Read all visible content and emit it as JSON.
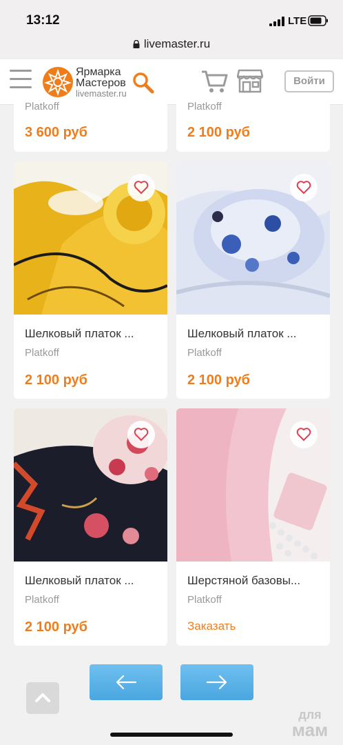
{
  "status_bar": {
    "time": "13:12",
    "network": "LTE"
  },
  "url_bar": {
    "url": "livemaster.ru"
  },
  "header": {
    "logo_line1": "Ярмарка",
    "logo_line2": "Мастеров",
    "logo_domain": "livemaster.ru",
    "login_label": "Войти"
  },
  "products": [
    {
      "title": "",
      "seller": "Platkoff",
      "price": "3 600 руб"
    },
    {
      "title": "",
      "seller": "Platkoff",
      "price": "2 100 руб"
    },
    {
      "title": "Шелковый платок ...",
      "seller": "Platkoff",
      "price": "2 100 руб"
    },
    {
      "title": "Шелковый платок ...",
      "seller": "Platkoff",
      "price": "2 100 руб"
    },
    {
      "title": "Шелковый платок ...",
      "seller": "Platkoff",
      "price": "2 100 руб"
    },
    {
      "title": "Шерстяной базовы...",
      "seller": "Platkoff",
      "action": "Заказать"
    }
  ],
  "watermark": {
    "line1": "для",
    "line2": "мам"
  },
  "colors": {
    "accent": "#f07d1c",
    "pager_button": "#55ade6",
    "heart": "#e0404e"
  }
}
